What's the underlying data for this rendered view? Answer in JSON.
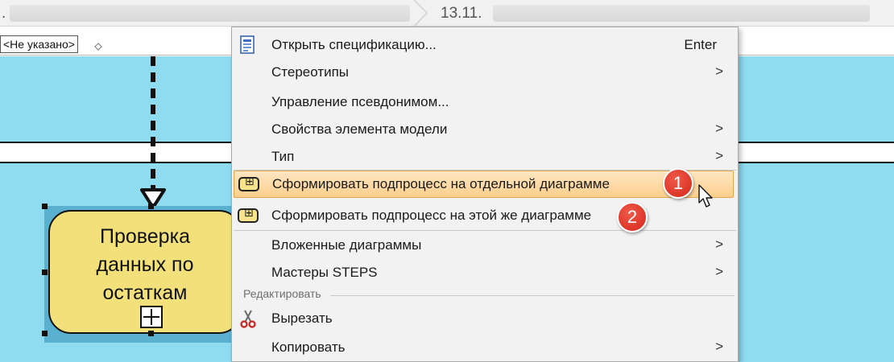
{
  "breadcrumb": {
    "first_crumb_text": ".",
    "second_crumb_text": "13.11."
  },
  "properties_bar": {
    "selected_value": "<Не указано>"
  },
  "diagram": {
    "task_text": "Проверка данных по остаткам"
  },
  "context_menu": {
    "items": [
      {
        "label": "Открыть спецификацию...",
        "shortcut": "Enter",
        "icon": "specification-icon",
        "submenu": false
      },
      {
        "label": "Стереотипы",
        "submenu": true
      },
      {
        "label": "Управление псевдонимом...",
        "submenu": false
      },
      {
        "label": "Свойства элемента модели",
        "submenu": true
      },
      {
        "label": "Тип",
        "submenu": true
      },
      {
        "label": "Сформировать подпроцесс на отдельной диаграмме",
        "icon": "subprocess-icon",
        "highlighted": true,
        "submenu": false
      },
      {
        "label": "Сформировать подпроцесс на этой же диаграмме",
        "icon": "subprocess-icon",
        "submenu": false
      },
      {
        "label": "Вложенные диаграммы",
        "submenu": true
      },
      {
        "label": "Мастеры STEPS",
        "submenu": true
      }
    ],
    "edit_group": {
      "header": "Редактировать",
      "items": [
        {
          "label": "Вырезать",
          "icon": "scissors-icon",
          "submenu": false
        },
        {
          "label": "Копировать",
          "submenu": true
        }
      ]
    },
    "submenu_arrow": ">"
  },
  "callouts": [
    "1",
    "2"
  ],
  "colors": {
    "canvas_background": "#8fdcf1",
    "task_fill": "#f2e17b",
    "menu_background": "#f2f2f2",
    "highlight_fill": "#fbcf8d",
    "callout_red": "#d4261a"
  }
}
